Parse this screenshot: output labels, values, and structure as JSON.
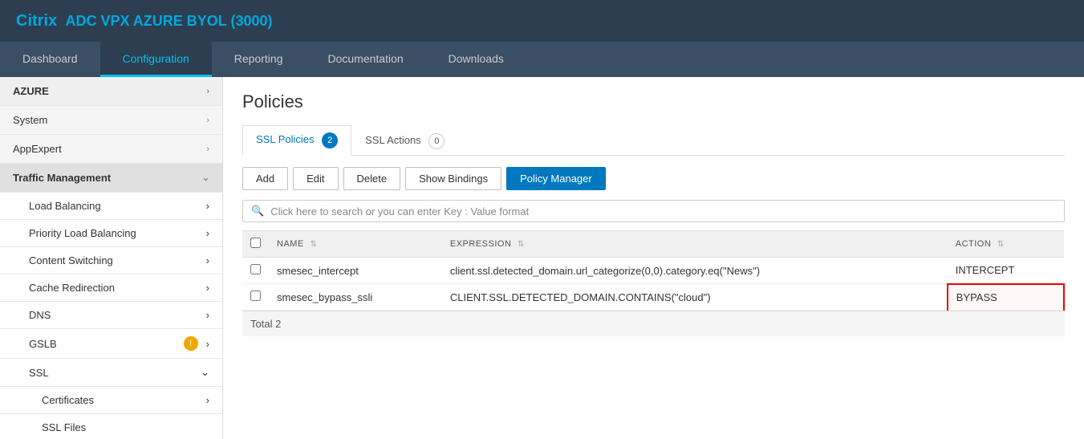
{
  "header": {
    "brand_highlight": "Citrix",
    "brand_rest": " ADC VPX AZURE BYOL (3000)"
  },
  "nav": {
    "tabs": [
      {
        "label": "Dashboard",
        "active": false
      },
      {
        "label": "Configuration",
        "active": true
      },
      {
        "label": "Reporting",
        "active": false
      },
      {
        "label": "Documentation",
        "active": false
      },
      {
        "label": "Downloads",
        "active": false
      }
    ]
  },
  "sidebar": {
    "items": [
      {
        "label": "AZURE",
        "type": "section",
        "chevron": "›"
      },
      {
        "label": "System",
        "type": "item",
        "chevron": "›"
      },
      {
        "label": "AppExpert",
        "type": "item",
        "chevron": "›"
      },
      {
        "label": "Traffic Management",
        "type": "item-bold",
        "chevron": "⌄"
      },
      {
        "label": "Load Balancing",
        "type": "subitem",
        "chevron": "›"
      },
      {
        "label": "Priority Load Balancing",
        "type": "subitem",
        "chevron": "›"
      },
      {
        "label": "Content Switching",
        "type": "subitem",
        "chevron": "›"
      },
      {
        "label": "Cache Redirection",
        "type": "subitem",
        "chevron": "›"
      },
      {
        "label": "DNS",
        "type": "subitem",
        "chevron": "›"
      },
      {
        "label": "GSLB",
        "type": "subitem-badge",
        "chevron": "›",
        "badge": "!"
      },
      {
        "label": "SSL",
        "type": "subitem",
        "chevron": "⌄"
      },
      {
        "label": "Certificates",
        "type": "subsubitem",
        "chevron": "›"
      },
      {
        "label": "SSL Files",
        "type": "subsubitem",
        "chevron": ""
      }
    ]
  },
  "main": {
    "page_title": "Policies",
    "tabs": [
      {
        "label": "SSL Policies",
        "badge": "2",
        "active": true
      },
      {
        "label": "SSL Actions",
        "badge": "0",
        "active": false
      }
    ],
    "buttons": [
      {
        "label": "Add",
        "type": "default"
      },
      {
        "label": "Edit",
        "type": "default"
      },
      {
        "label": "Delete",
        "type": "default"
      },
      {
        "label": "Show Bindings",
        "type": "default"
      },
      {
        "label": "Policy Manager",
        "type": "primary"
      }
    ],
    "search_placeholder": "Click here to search or you can enter Key : Value format",
    "table": {
      "columns": [
        {
          "label": "",
          "key": "checkbox"
        },
        {
          "label": "NAME",
          "sortable": true
        },
        {
          "label": "EXPRESSION",
          "sortable": true
        },
        {
          "label": "ACTION",
          "sortable": true
        }
      ],
      "rows": [
        {
          "name": "smesec_intercept",
          "expression": "client.ssl.detected_domain.url_categorize(0,0).category.eq(\"News\")",
          "action": "INTERCEPT",
          "highlighted": false
        },
        {
          "name": "smesec_bypass_ssli",
          "expression": "CLIENT.SSL.DETECTED_DOMAIN.CONTAINS(\"cloud\")",
          "action": "BYPASS",
          "highlighted": true
        }
      ],
      "footer": "Total  2"
    }
  }
}
